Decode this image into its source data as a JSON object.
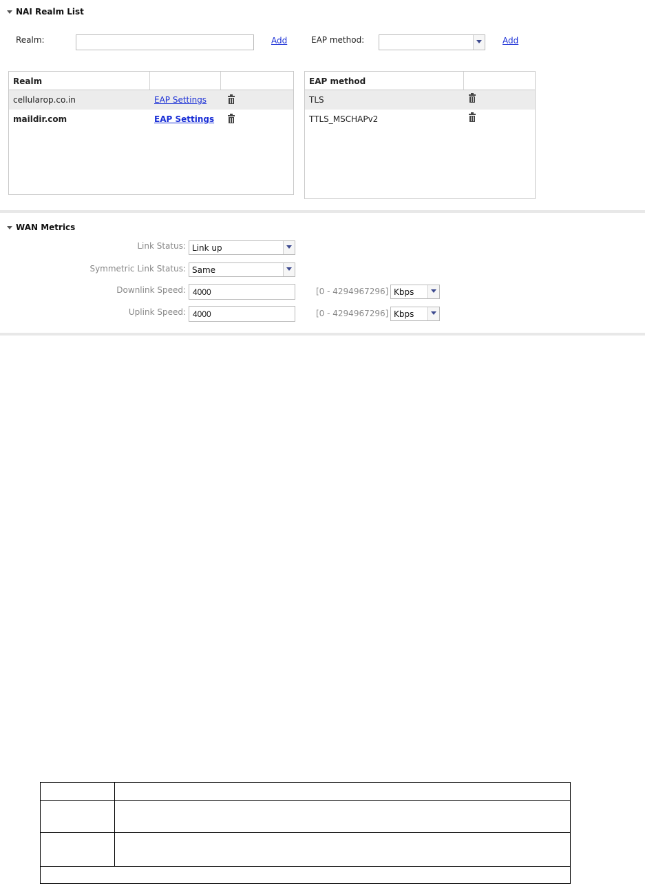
{
  "nai_realm": {
    "title": "NAI Realm List",
    "realm_label": "Realm:",
    "realm_value": "",
    "add_realm_label": "Add",
    "eap_label": "EAP method:",
    "eap_value": "",
    "add_eap_label": "Add",
    "realm_table": {
      "columns": [
        "Realm",
        "",
        ""
      ],
      "rows": [
        {
          "realm": "cellularop.co.in",
          "link": "EAP Settings",
          "selected": true
        },
        {
          "realm": "maildir.com",
          "link": "EAP Settings",
          "bold": true
        }
      ]
    },
    "eap_table": {
      "columns": [
        "EAP method",
        ""
      ],
      "rows": [
        {
          "method": "TLS",
          "selected": true
        },
        {
          "method": "TTLS_MSCHAPv2"
        }
      ]
    }
  },
  "wan": {
    "title": "WAN Metrics",
    "link_status_label": "Link Status:",
    "link_status_value": "Link up",
    "symmetric_label": "Symmetric Link Status:",
    "symmetric_value": "Same",
    "downlink_label": "Downlink Speed:",
    "downlink_value": "4000",
    "downlink_range": "[0 - 4294967296]",
    "downlink_unit": "Kbps",
    "uplink_label": "Uplink Speed:",
    "uplink_value": "4000",
    "uplink_range": "[0 - 4294967296]",
    "uplink_unit": "Kbps"
  },
  "colors": {
    "link": "#1a2fd6",
    "selected_row": "#ececec",
    "divider": "#e8e8e8"
  }
}
